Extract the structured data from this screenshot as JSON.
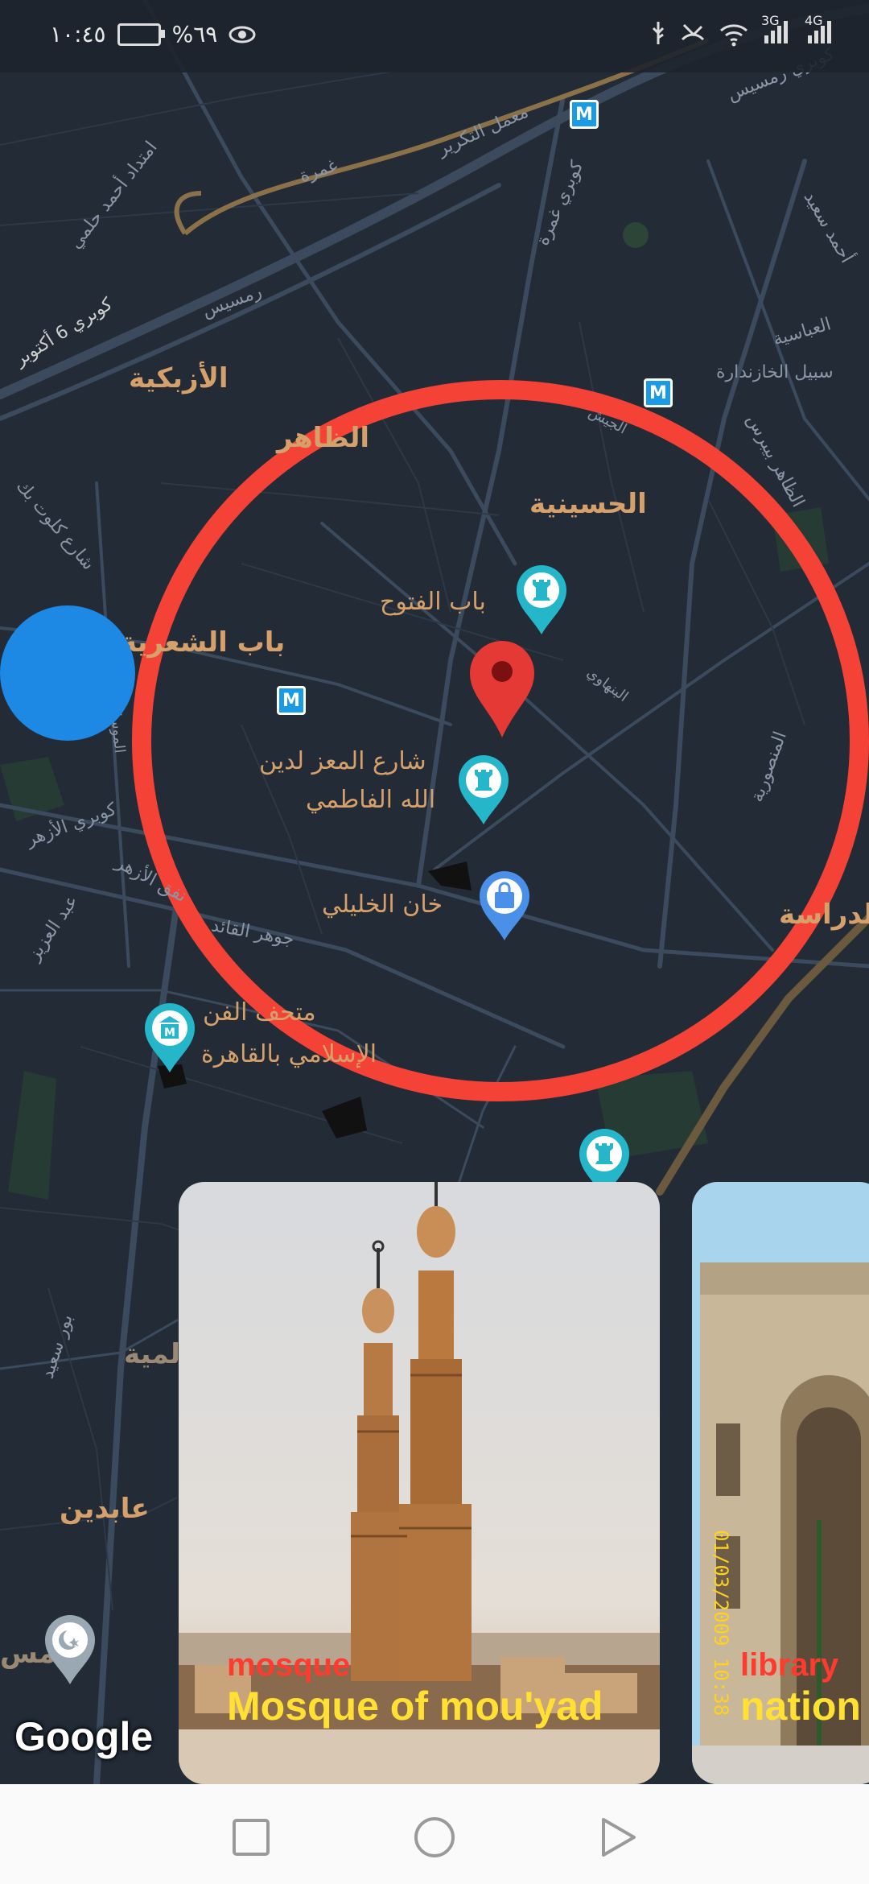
{
  "status_bar": {
    "time": "١٠:٤٥",
    "battery": "%٦٩",
    "network_labels": [
      "3G",
      "4G"
    ]
  },
  "map": {
    "districts": [
      {
        "id": "azbakeya",
        "text": "الأزبكية"
      },
      {
        "id": "zaher",
        "text": "الظاهر"
      },
      {
        "id": "hussainia",
        "text": "الحسينية"
      },
      {
        "id": "bab_shaareya",
        "text": "باب الشعرية"
      },
      {
        "id": "darrasa",
        "text": "الدراسة"
      },
      {
        "id": "abdeen",
        "text": "عابدين"
      },
      {
        "id": "alamiya",
        "text": "لمية"
      },
      {
        "id": "mas",
        "text": "مس"
      }
    ],
    "pois": [
      {
        "id": "bab_futuh",
        "text": "باب الفتوح"
      },
      {
        "id": "moez_line1",
        "text": "شارع المعز لدين"
      },
      {
        "id": "moez_line2",
        "text": "الله الفاطمي"
      },
      {
        "id": "khan",
        "text": "خان الخليلي"
      },
      {
        "id": "museum_line1",
        "text": "متحف الفن"
      },
      {
        "id": "museum_line2",
        "text": "الإسلامي بالقاهرة"
      }
    ],
    "streets": [
      {
        "id": "s1",
        "text": "كوبري رمسيس"
      },
      {
        "id": "s2",
        "text": "معمل التكرير"
      },
      {
        "id": "s3",
        "text": "امتداد أحمد حلمي"
      },
      {
        "id": "s4",
        "text": "غمرة"
      },
      {
        "id": "s5",
        "text": "كوبري غمرة"
      },
      {
        "id": "s6",
        "text": "أحمد سعيد"
      },
      {
        "id": "s7",
        "text": "العباسية"
      },
      {
        "id": "s8",
        "text": "سبيل الخازندارة"
      },
      {
        "id": "s9",
        "text": "كوبري 6 أكتوبر"
      },
      {
        "id": "s10",
        "text": "رمسيس"
      },
      {
        "id": "s11",
        "text": "الجيش"
      },
      {
        "id": "s12",
        "text": "الظاهر بيبرس"
      },
      {
        "id": "s13",
        "text": "شارع كلوت بك"
      },
      {
        "id": "s14",
        "text": "البنهاوي"
      },
      {
        "id": "s15",
        "text": "المنصورية"
      },
      {
        "id": "s16",
        "text": "كوبري الأزهر"
      },
      {
        "id": "s17",
        "text": "نفق الأزهر"
      },
      {
        "id": "s18",
        "text": "عبد العزيز"
      },
      {
        "id": "s19",
        "text": "جوهر القائد"
      },
      {
        "id": "s20",
        "text": "بور سعيد"
      },
      {
        "id": "s21",
        "text": "الموسكي"
      }
    ],
    "metro_label": "M",
    "google_logo": "Google"
  },
  "cards": [
    {
      "category": "mosque",
      "title": "Mosque of mou'yad"
    },
    {
      "category": "library",
      "title": "nation",
      "stamp": "01/03/2009 10:38"
    }
  ],
  "colors": {
    "map_bg": "#222b36",
    "radius_circle": "#f44336",
    "label_orange": "#d6a06a",
    "category_red": "#ff3b30",
    "title_yellow": "#ffe033",
    "pin_teal": "#26b6c9",
    "pin_blue": "#4a8fe8",
    "user_dot": "#1e88e5"
  },
  "icons": [
    "wifi-icon",
    "signal-icon",
    "eye-icon",
    "usb-icon",
    "missed-call-icon",
    "red-pin-icon",
    "monument-pin-icon",
    "shopping-pin-icon",
    "museum-pin-icon",
    "mosque-pin-icon",
    "metro-icon",
    "back-icon",
    "home-icon",
    "recents-icon"
  ]
}
